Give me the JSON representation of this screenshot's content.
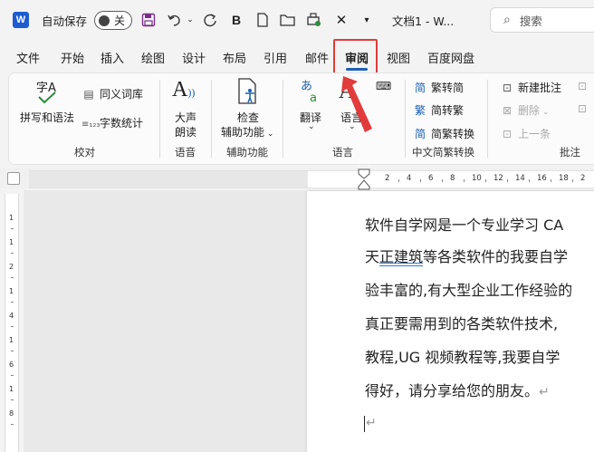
{
  "titlebar": {
    "app_logo": "W",
    "autosave_label": "自动保存",
    "autosave_state": "关",
    "bold_label": "B",
    "doc_title": "文档1 - W...",
    "search_placeholder": "搜索",
    "icons": [
      "save-icon",
      "undo-icon",
      "redo-icon",
      "bold-icon",
      "new-doc-icon",
      "open-folder-icon",
      "print-preview-icon",
      "close-icon",
      "dropdown-icon"
    ]
  },
  "tabs": [
    {
      "label": "文件"
    },
    {
      "label": "开始"
    },
    {
      "label": "插入"
    },
    {
      "label": "绘图"
    },
    {
      "label": "设计"
    },
    {
      "label": "布局"
    },
    {
      "label": "引用"
    },
    {
      "label": "邮件"
    },
    {
      "label": "审阅",
      "active": true
    },
    {
      "label": "视图"
    },
    {
      "label": "百度网盘"
    }
  ],
  "ribbon": {
    "proofing": {
      "spelling_icon_text": "字A",
      "spelling_label": "拼写和语法",
      "thesaurus_label": "同义词库",
      "wordcount_label": "字数统计",
      "group_label": "校对"
    },
    "speech": {
      "read_aloud_label_1": "大声",
      "read_aloud_label_2": "朗读",
      "group_label": "语音"
    },
    "accessibility": {
      "check_label_1": "检查",
      "check_label_2": "辅助功能",
      "group_label": "辅助功能"
    },
    "language": {
      "translate_label": "翻译",
      "language_label": "语言",
      "group_label": "语言"
    },
    "chinese_conversion": {
      "trad_to_simp": "繁转简",
      "simp_to_trad": "简转繁",
      "convert": "简繁转换",
      "group_label": "中文简繁转换"
    },
    "comments": {
      "new_comment": "新建批注",
      "delete": "删除",
      "previous": "上一条",
      "group_label": "批注"
    }
  },
  "ruler": {
    "numbers": [
      "2",
      "4",
      "6",
      "8",
      "10",
      "12",
      "14",
      "16",
      "18",
      "2"
    ]
  },
  "vruler": {
    "numbers": [
      "1",
      "1",
      "2",
      "1",
      "4",
      "1",
      "6",
      "1",
      "8"
    ]
  },
  "document": {
    "line1": "软件自学网是一个专业学习 CA",
    "line2_a": "天",
    "line2_u": "正建筑",
    "line2_b": "等各类软件的我要自学",
    "line3": "验丰富的,有大型企业工作经验的",
    "line4": "真正要需用到的各类软件技术,",
    "line5": "教程,UG  视频教程等,我要自学",
    "line6": "得好，请分享给您的朋友。",
    "pilcrow": "↵"
  },
  "colors": {
    "accent": "#1a5fb4",
    "highlight": "#e23b3b",
    "word_blue": "#1e5ccf"
  }
}
